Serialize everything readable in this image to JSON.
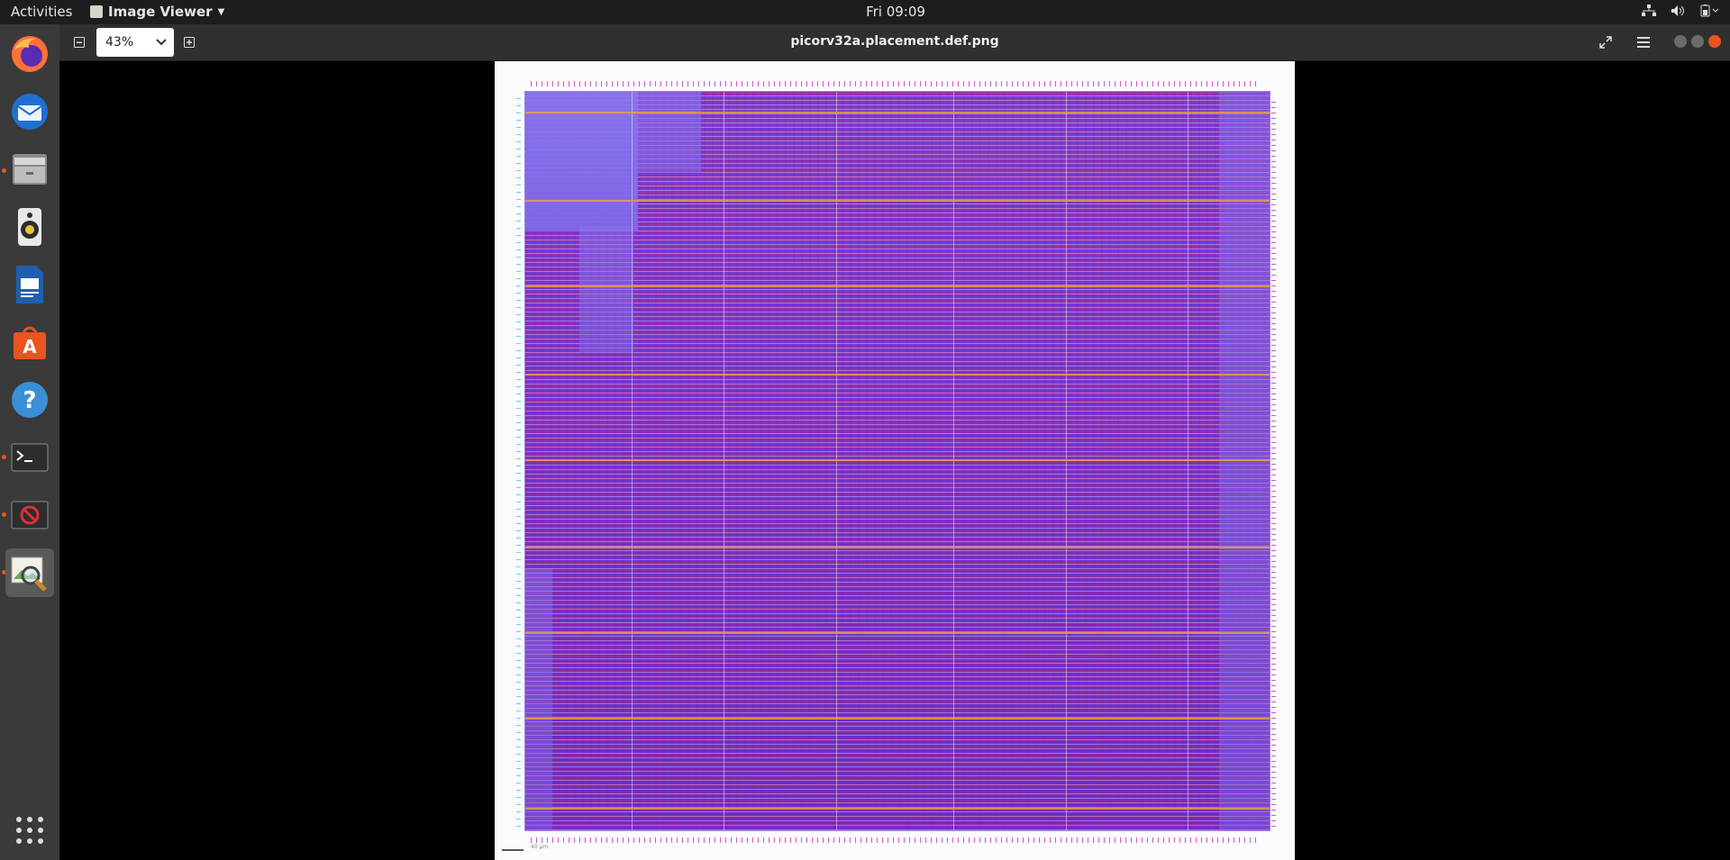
{
  "topbar": {
    "activities": "Activities",
    "app_name": "Image Viewer",
    "clock": "Fri 09:09",
    "tray": {
      "network_icon": "network-icon",
      "volume_icon": "volume-icon",
      "battery_icon": "battery-icon"
    }
  },
  "dock": {
    "items": [
      {
        "name": "firefox",
        "icon": "firefox-icon",
        "running": false
      },
      {
        "name": "thunderbird",
        "icon": "mail-icon",
        "running": false
      },
      {
        "name": "files",
        "icon": "files-icon",
        "running": true
      },
      {
        "name": "rhythmbox",
        "icon": "speaker-icon",
        "running": false
      },
      {
        "name": "libreoffice-writer",
        "icon": "writer-icon",
        "running": false
      },
      {
        "name": "software",
        "icon": "software-store-icon",
        "running": false
      },
      {
        "name": "help",
        "icon": "help-icon",
        "running": false
      },
      {
        "name": "terminal",
        "icon": "terminal-icon",
        "running": true
      },
      {
        "name": "blocked-app",
        "icon": "blocked-icon",
        "running": true
      },
      {
        "name": "image-viewer",
        "icon": "image-viewer-icon",
        "running": true,
        "active": true
      }
    ],
    "show_apps_icon": "app-grid-icon"
  },
  "viewer": {
    "zoom_out_icon": "zoom-out-icon",
    "zoom_value": "43%",
    "zoom_in_icon": "zoom-in-icon",
    "title": "picorv32a.placement.def.png",
    "fullscreen_icon": "fullscreen-icon",
    "menu_icon": "hamburger-menu-icon",
    "scalebar_label": "40 µm"
  },
  "colors": {
    "topbar_bg": "#1d1d1d",
    "dock_bg": "#3a3a3a",
    "headerbar_bg": "#303030",
    "accent": "#e95420",
    "cell_fill": "#7a3bd6",
    "power_rail": "#e8a040"
  }
}
